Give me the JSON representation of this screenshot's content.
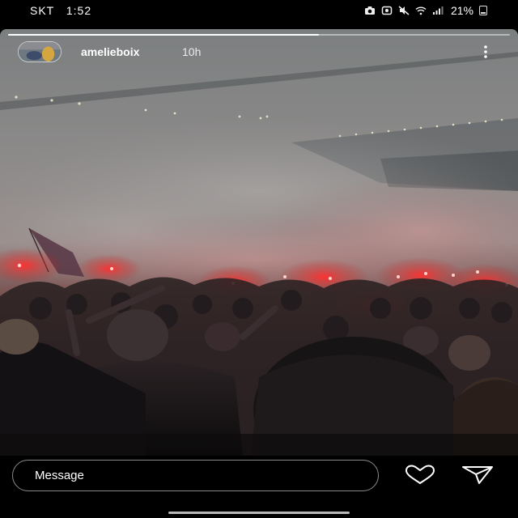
{
  "status_bar": {
    "carrier": "SKT",
    "time": "1:52",
    "battery_percent": "21%",
    "icons": [
      "camera-icon",
      "alarm-icon",
      "mute-icon",
      "wifi-icon",
      "signal-icon",
      "battery-icon"
    ]
  },
  "story": {
    "username": "amelieboix",
    "timestamp": "10h",
    "progress": 0.62,
    "media_description_icon": "stadium-crowd-flares-photo",
    "more_icon": "more-vertical-icon"
  },
  "reply_bar": {
    "placeholder": "Message",
    "like_icon": "heart-icon",
    "send_icon": "send-icon"
  },
  "colors": {
    "background": "#000000",
    "text": "#ffffff",
    "flare_red": "#ff2a2a",
    "smoke": "#8f8a88"
  }
}
